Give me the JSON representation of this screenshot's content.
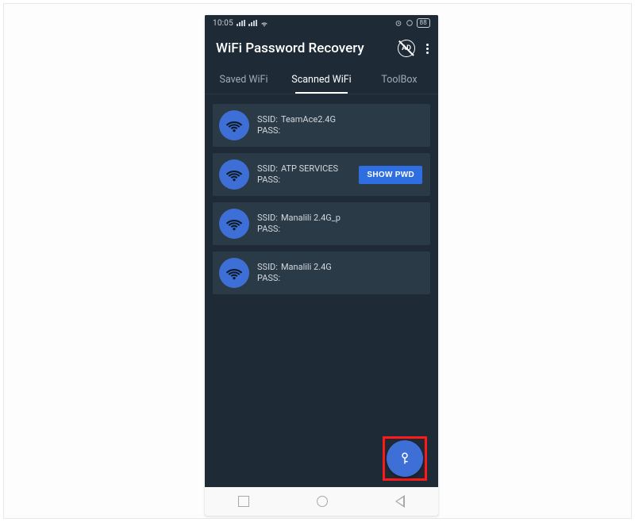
{
  "statusbar": {
    "time": "10:05",
    "battery": "88"
  },
  "header": {
    "title": "WiFi Password Recovery",
    "ad_label": "AD"
  },
  "tabs": [
    {
      "label": "Saved WiFi",
      "active": false
    },
    {
      "label": "Scanned WiFi",
      "active": true
    },
    {
      "label": "ToolBox",
      "active": false
    }
  ],
  "labels": {
    "ssid_prefix": "SSID:",
    "pass_prefix": "PASS:",
    "show_pwd": "SHOW PWD"
  },
  "networks": [
    {
      "ssid": "TeamAce2.4G",
      "pass": "",
      "show_button": false
    },
    {
      "ssid": "ATP SERVICES",
      "pass": "",
      "show_button": true
    },
    {
      "ssid": "Manalili 2.4G_p",
      "pass": "",
      "show_button": false
    },
    {
      "ssid": "Manalili 2.4G",
      "pass": "",
      "show_button": false
    }
  ]
}
